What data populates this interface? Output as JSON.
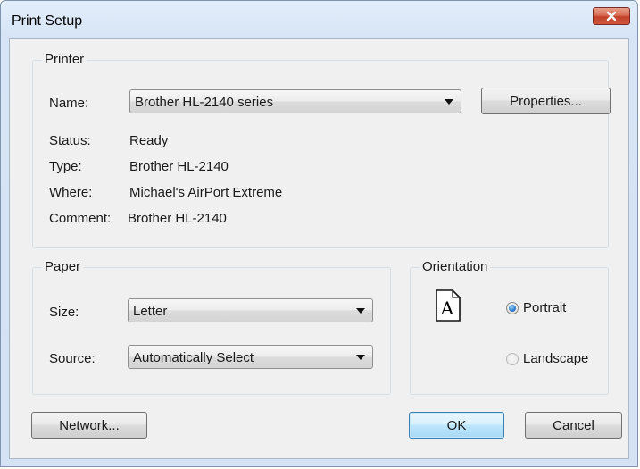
{
  "window": {
    "title": "Print Setup"
  },
  "printer": {
    "group_label": "Printer",
    "name_label": "Name:",
    "name_value": "Brother HL-2140 series",
    "properties_button": "Properties...",
    "status_label": "Status:",
    "status_value": "Ready",
    "type_label": "Type:",
    "type_value": "Brother HL-2140",
    "where_label": "Where:",
    "where_value": "Michael's AirPort Extreme",
    "comment_label": "Comment:",
    "comment_value": "Brother HL-2140"
  },
  "paper": {
    "group_label": "Paper",
    "size_label": "Size:",
    "size_value": "Letter",
    "source_label": "Source:",
    "source_value": "Automatically Select"
  },
  "orientation": {
    "group_label": "Orientation",
    "icon_letter": "A",
    "portrait_label": "Portrait",
    "landscape_label": "Landscape",
    "selected": "Portrait"
  },
  "buttons": {
    "network": "Network...",
    "ok": "OK",
    "cancel": "Cancel"
  },
  "icons": {
    "close": "close-icon",
    "dropdown": "chevron-down-icon",
    "page_orientation": "document-portrait-icon"
  },
  "colors": {
    "close_button": "#c9472f",
    "default_button_border": "#3c7fb1",
    "radio_selected": "#2a78c8",
    "client_background": "#f0f0f0"
  }
}
